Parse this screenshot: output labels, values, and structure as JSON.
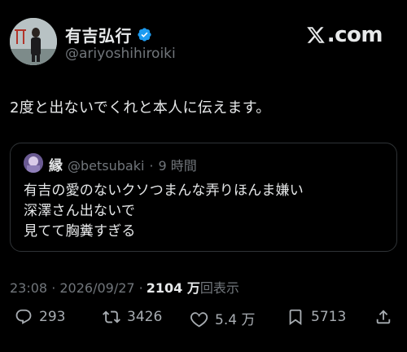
{
  "header": {
    "name": "有吉弘行",
    "handle": "@ariyoshihiroiki",
    "brand": ".com"
  },
  "tweet": {
    "text": "2度と出ないでくれと本人に伝えます。"
  },
  "quote": {
    "name": "縁",
    "handle": "@betsubaki",
    "dot": "·",
    "time": "9 時間",
    "lines": [
      "有吉の愛のないクソつまんな弄りほんま嫌い",
      "深澤さん出ないで",
      "見てて胸糞すぎる"
    ]
  },
  "meta": {
    "timestamp": "23:08 · 2026/09/27 ·",
    "views": "2104 万",
    "views_label": "回表示"
  },
  "actions": {
    "reply_count": "293",
    "retweet_count": "3426",
    "like_count": "5.4 万",
    "bookmark_count": "5713"
  },
  "colors": {
    "background": "#000000",
    "text": "#e7e9ea",
    "secondary": "#71767b",
    "verified": "#1d9bf0"
  }
}
